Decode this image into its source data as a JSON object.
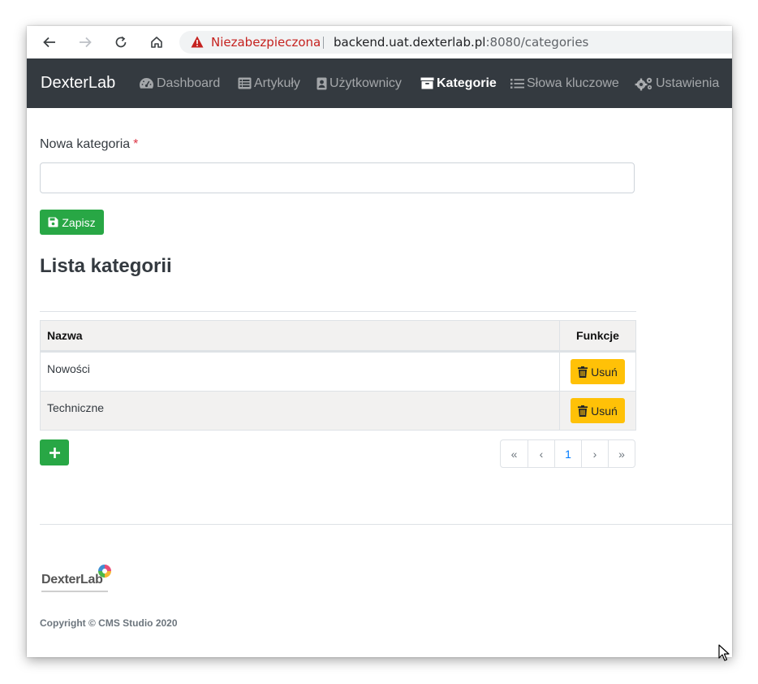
{
  "browser": {
    "security_label": "Niezabezpieczona",
    "url_host": "backend.uat.dexterlab.pl",
    "url_port_path": ":8080/categories"
  },
  "navbar": {
    "brand": "DexterLab",
    "items": [
      {
        "label": "Dashboard",
        "icon": "dashboard-gauge-icon"
      },
      {
        "label": "Artykuły",
        "icon": "list-alt-icon"
      },
      {
        "label": "Użytkownicy",
        "icon": "address-card-icon"
      },
      {
        "label": "Kategorie",
        "icon": "archive-box-icon",
        "active": true
      },
      {
        "label": "Słowa kluczowe",
        "icon": "list-icon"
      },
      {
        "label": "Ustawienia",
        "icon": "cogs-icon"
      }
    ]
  },
  "form": {
    "label": "Nowa kategoria",
    "required_mark": "*",
    "input_value": "",
    "save_label": "Zapisz"
  },
  "list": {
    "heading": "Lista kategorii",
    "columns": [
      "Nazwa",
      "Funkcje"
    ],
    "rows": [
      {
        "name": "Nowości",
        "action": "Usuń"
      },
      {
        "name": "Techniczne",
        "action": "Usuń"
      }
    ],
    "add_icon": "plus-icon"
  },
  "pagination": {
    "first": "«",
    "prev": "‹",
    "current": "1",
    "next": "›",
    "last": "»"
  },
  "footer": {
    "logo_text": "DexterLab",
    "copyright": "Copyright © CMS Studio 2020"
  },
  "colors": {
    "navbar_bg": "#343a40",
    "success": "#28a745",
    "warning": "#ffc107",
    "danger": "#dc3545",
    "link": "#007bff"
  }
}
